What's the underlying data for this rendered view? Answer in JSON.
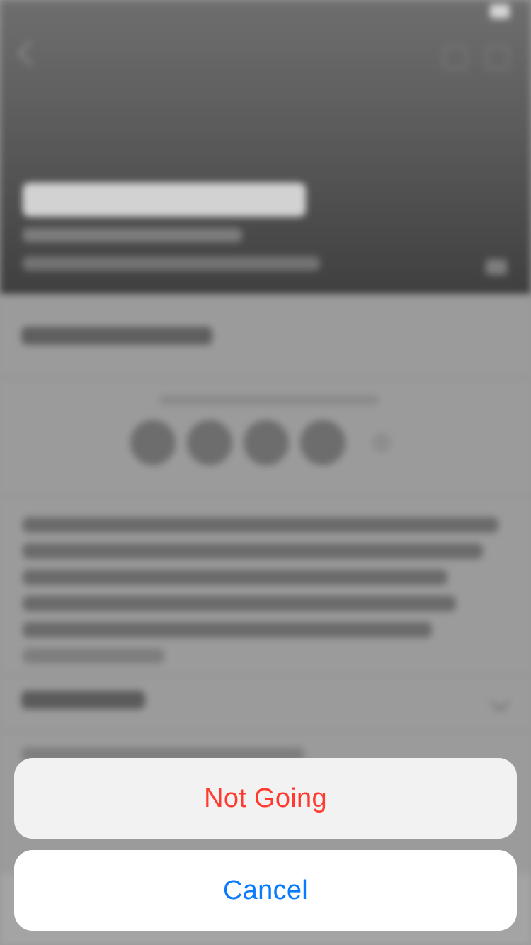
{
  "action_sheet": {
    "destructive_option_label": "Not Going",
    "cancel_label": "Cancel"
  },
  "colors": {
    "destructive": "#ff3b30",
    "accent": "#0a7aff",
    "sheet_background": "#ffffff",
    "dimmed_background": "#9a9a9a"
  },
  "icons": {
    "back": "chevron-left-icon",
    "header_actions": [
      "calendar-icon",
      "more-icon"
    ],
    "share": "share-icon",
    "expand": "chevron-down-icon"
  }
}
